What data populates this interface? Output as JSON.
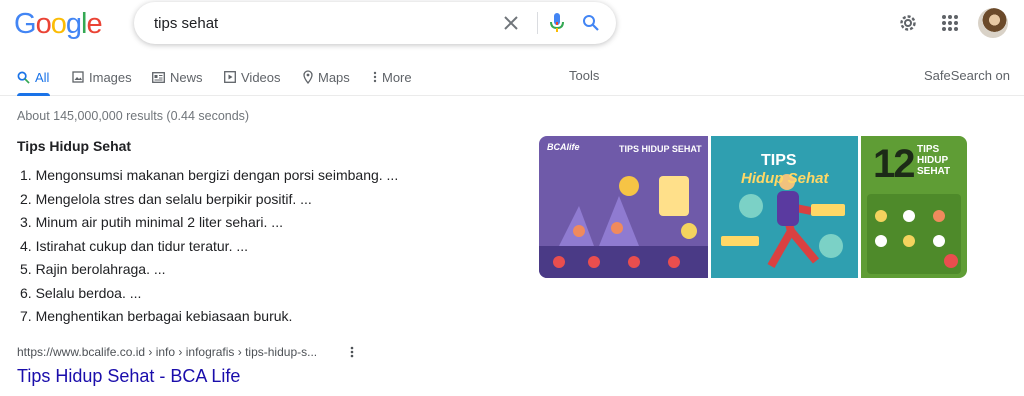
{
  "logo": {
    "letters": [
      "G",
      "o",
      "o",
      "g",
      "l",
      "e"
    ],
    "colors": [
      "#4285F4",
      "#EA4335",
      "#FBBC05",
      "#4285F4",
      "#34A853",
      "#EA4335"
    ]
  },
  "search": {
    "value": "tips sehat"
  },
  "header_icons": [
    "close-icon",
    "mic-icon",
    "search-icon",
    "gear-icon",
    "apps-icon"
  ],
  "tabs": [
    {
      "label": "All",
      "icon": "search-icon"
    },
    {
      "label": "Images",
      "icon": "image-icon"
    },
    {
      "label": "News",
      "icon": "news-icon"
    },
    {
      "label": "Videos",
      "icon": "video-icon"
    },
    {
      "label": "Maps",
      "icon": "map-pin-icon"
    },
    {
      "label": "More",
      "icon": "more-vert-icon"
    }
  ],
  "tools_label": "Tools",
  "safesearch_label": "SafeSearch on",
  "stats": "About 145,000,000 results (0.44 seconds)",
  "snippet": {
    "title": "Tips Hidup Sehat",
    "items": [
      "1. Mengonsumsi makanan bergizi dengan porsi seimbang. ...",
      "2. Mengelola stres dan selalu berpikir positif. ...",
      "3. Minum air putih minimal 2 liter sehari. ...",
      "4. Istirahat cukup dan tidur teratur. ...",
      "5. Rajin berolahraga. ...",
      "6. Selalu berdoa. ...",
      "7. Menghentikan berbagai kebiasaan buruk."
    ]
  },
  "images": [
    {
      "brand": "BCAlife",
      "heading": "TIPS HIDUP SEHAT"
    },
    {
      "heading": "TIPS",
      "subheading": "Hidup Sehat"
    },
    {
      "number": "12",
      "heading": "TIPS HIDUP SEHAT"
    }
  ],
  "result": {
    "cite": "https://www.bcalife.co.id › info › infografis › tips-hidup-s...",
    "title": "Tips Hidup Sehat - BCA Life"
  },
  "colors": {
    "accent": "#1a73e8",
    "link": "#1a0dab",
    "muted": "#70757a"
  }
}
